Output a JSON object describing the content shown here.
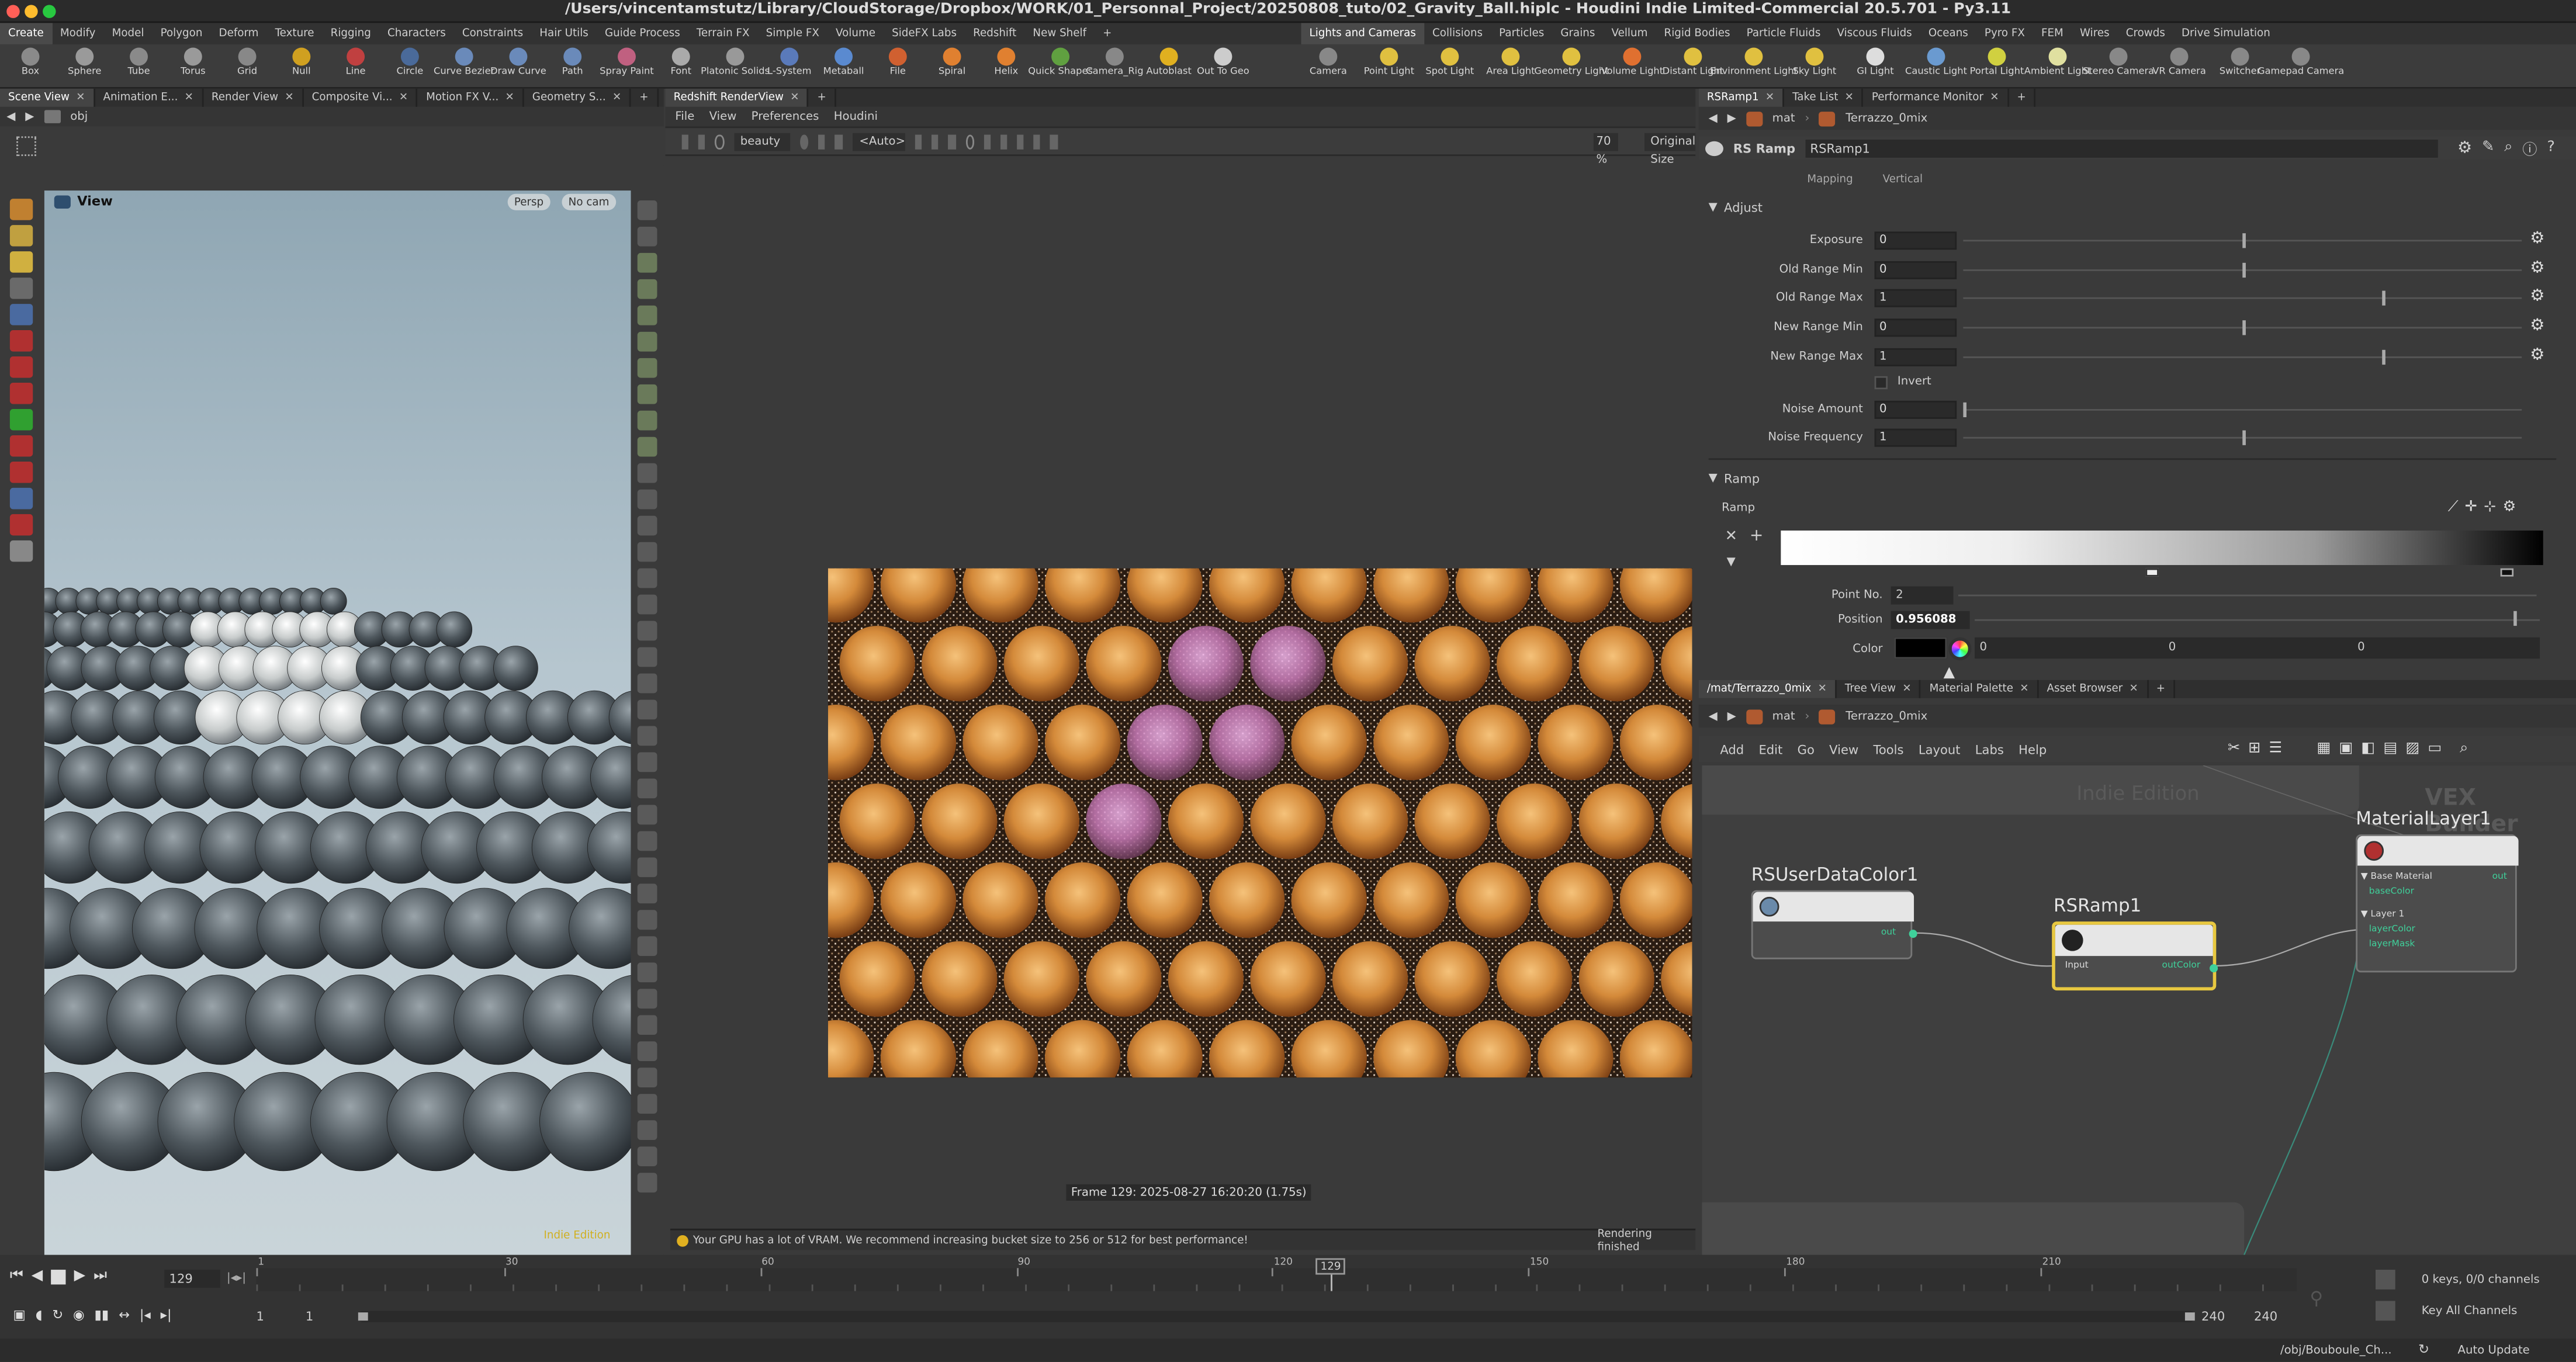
{
  "window": {
    "title": "/Users/vincentamstutz/Library/CloudStorage/Dropbox/WORK/01_Personnal_Project/20250808_tuto/02_Gravity_Ball.hiplc - Houdini Indie Limited-Commercial 20.5.701 - Py3.11"
  },
  "shelf_tabs_left": [
    "Create",
    "Modify",
    "Model",
    "Polygon",
    "Deform",
    "Texture",
    "Rigging",
    "Characters",
    "Constraints",
    "Hair Utils",
    "Guide Process",
    "Terrain FX",
    "Simple FX",
    "Volume",
    "SideFX Labs",
    "Redshift",
    "New Shelf"
  ],
  "shelf_tabs_right": [
    "Lights and Cameras",
    "Collisions",
    "Particles",
    "Grains",
    "Vellum",
    "Rigid Bodies",
    "Particle Fluids",
    "Viscous Fluids",
    "Oceans",
    "Pyro FX",
    "FEM",
    "Wires",
    "Crowds",
    "Drive Simulation"
  ],
  "tools_left": [
    {
      "label": "Box",
      "color": "#8a8a8a"
    },
    {
      "label": "Sphere",
      "color": "#9a9a9a"
    },
    {
      "label": "Tube",
      "color": "#8a8a8a"
    },
    {
      "label": "Torus",
      "color": "#9a9a9a"
    },
    {
      "label": "Grid",
      "color": "#888"
    },
    {
      "label": "Null",
      "color": "#d0a020"
    },
    {
      "label": "Line",
      "color": "#c04040"
    },
    {
      "label": "Circle",
      "color": "#4a6a9a"
    },
    {
      "label": "Curve Bezier",
      "color": "#6a8aba"
    },
    {
      "label": "Draw Curve",
      "color": "#6a8aba"
    },
    {
      "label": "Path",
      "color": "#6a8aba"
    },
    {
      "label": "Spray Paint",
      "color": "#c06080"
    },
    {
      "label": "Font",
      "color": "#aaaaaa"
    },
    {
      "label": "Platonic Solids",
      "color": "#999"
    },
    {
      "label": "L-System",
      "color": "#5a7aba"
    },
    {
      "label": "Metaball",
      "color": "#5a8ad0"
    },
    {
      "label": "File",
      "color": "#d06030"
    },
    {
      "label": "Spiral",
      "color": "#e08030"
    },
    {
      "label": "Helix",
      "color": "#e08030"
    },
    {
      "label": "Quick Shapes",
      "color": "#60a040"
    },
    {
      "label": "Camera_Rig",
      "color": "#888"
    },
    {
      "label": "Autoblast",
      "color": "#e0b020"
    },
    {
      "label": "Out To Geo",
      "color": "#cccccc"
    }
  ],
  "tools_right": [
    {
      "label": "Camera",
      "color": "#888"
    },
    {
      "label": "Point Light",
      "color": "#e0c040"
    },
    {
      "label": "Spot Light",
      "color": "#e0c040"
    },
    {
      "label": "Area Light",
      "color": "#e0c040"
    },
    {
      "label": "Geometry Light",
      "color": "#e0c040"
    },
    {
      "label": "Volume Light",
      "color": "#e07030"
    },
    {
      "label": "Distant Light",
      "color": "#e0c040"
    },
    {
      "label": "Environment Light",
      "color": "#e0c040"
    },
    {
      "label": "Sky Light",
      "color": "#e0c040"
    },
    {
      "label": "GI Light",
      "color": "#dddddd"
    },
    {
      "label": "Caustic Light",
      "color": "#6a9ad0"
    },
    {
      "label": "Portal Light",
      "color": "#d0d040"
    },
    {
      "label": "Ambient Light",
      "color": "#e0e0a0"
    },
    {
      "label": "Stereo Camera",
      "color": "#888"
    },
    {
      "label": "VR Camera",
      "color": "#888"
    },
    {
      "label": "Switcher",
      "color": "#888"
    },
    {
      "label": "Gamepad Camera",
      "color": "#888"
    }
  ],
  "left_pane_tabs": [
    "Scene View",
    "Animation E...",
    "Render View",
    "Composite Vi...",
    "Motion FX V...",
    "Geometry S..."
  ],
  "left_path": "obj",
  "viewport": {
    "label": "View",
    "persp": "Persp",
    "cam": "No cam",
    "watermark": "Indie Edition"
  },
  "render_tabs": [
    "Redshift RenderView"
  ],
  "render_menu": [
    "File",
    "View",
    "Preferences",
    "Houdini"
  ],
  "render_toolbar": {
    "aov": "beauty",
    "auto": "<Auto>",
    "zoom": "70 %",
    "size": "Original Size"
  },
  "render_info": "Frame 129: 2025-08-27 16:20:20 (1.75s)",
  "render_status": "Your GPU has a lot of VRAM. We recommend increasing bucket size to 256 or 512 for best performance!",
  "render_finished": "Rendering finished",
  "param_tabs": [
    "RSRamp1",
    "Take List",
    "Performance Monitor"
  ],
  "param_path": {
    "context": "mat",
    "node": "Terrazzo_0mix"
  },
  "param_node": {
    "type": "RS Ramp",
    "name": "RSRamp1",
    "mapping_label": "Mapping",
    "mapping_value": "Vertical"
  },
  "adjust": {
    "heading": "Adjust",
    "params": [
      {
        "label": "Exposure",
        "value": "0",
        "knob": 0.5
      },
      {
        "label": "Old Range Min",
        "value": "0",
        "knob": 0.5
      },
      {
        "label": "Old Range Max",
        "value": "1",
        "knob": 0.75
      },
      {
        "label": "New Range Min",
        "value": "0",
        "knob": 0.5
      },
      {
        "label": "New Range Max",
        "value": "1",
        "knob": 0.75
      }
    ],
    "invert": "Invert",
    "noise_amount": {
      "label": "Noise Amount",
      "value": "0",
      "knob": 0.0
    },
    "noise_freq": {
      "label": "Noise Frequency",
      "value": "1",
      "knob": 0.5
    }
  },
  "ramp": {
    "heading": "Ramp",
    "label": "Ramp",
    "point_no_label": "Point No.",
    "point_no": "2",
    "position_label": "Position",
    "position": "0.956088",
    "color_label": "Color",
    "color_values": [
      "0",
      "0",
      "0"
    ]
  },
  "net_tabs": [
    "/mat/Terrazzo_0mix",
    "Tree View",
    "Material Palette",
    "Asset Browser"
  ],
  "net_path": {
    "context": "mat",
    "node": "Terrazzo_0mix"
  },
  "net_menu": [
    "Add",
    "Edit",
    "Go",
    "View",
    "Tools",
    "Layout",
    "Labs",
    "Help"
  ],
  "net_watermarks": {
    "indie": "Indie Edition",
    "vex": "VEX Builder"
  },
  "nodes": {
    "userdata": {
      "title": "RSUserDataColor1",
      "out": "out"
    },
    "ramp": {
      "title": "RSRamp1",
      "in": "Input",
      "out": "outColor"
    },
    "layer": {
      "title": "MaterialLayer1",
      "base": "Base Material",
      "base_color": "baseColor",
      "out": "out",
      "layer1": "Layer 1",
      "layer_color": "layerColor",
      "layer_mask": "layerMask"
    }
  },
  "timeline": {
    "frame": "129",
    "ticks": [
      "1",
      "30",
      "60",
      "90",
      "120",
      "150",
      "180",
      "210"
    ],
    "current": "129",
    "start": "1",
    "start2": "1",
    "end": "240",
    "end2": "240",
    "keys": "0 keys, 0/0 channels",
    "key_all": "Key All Channels",
    "path": "/obj/Bouboule_Ch...",
    "auto_update": "Auto Update"
  }
}
